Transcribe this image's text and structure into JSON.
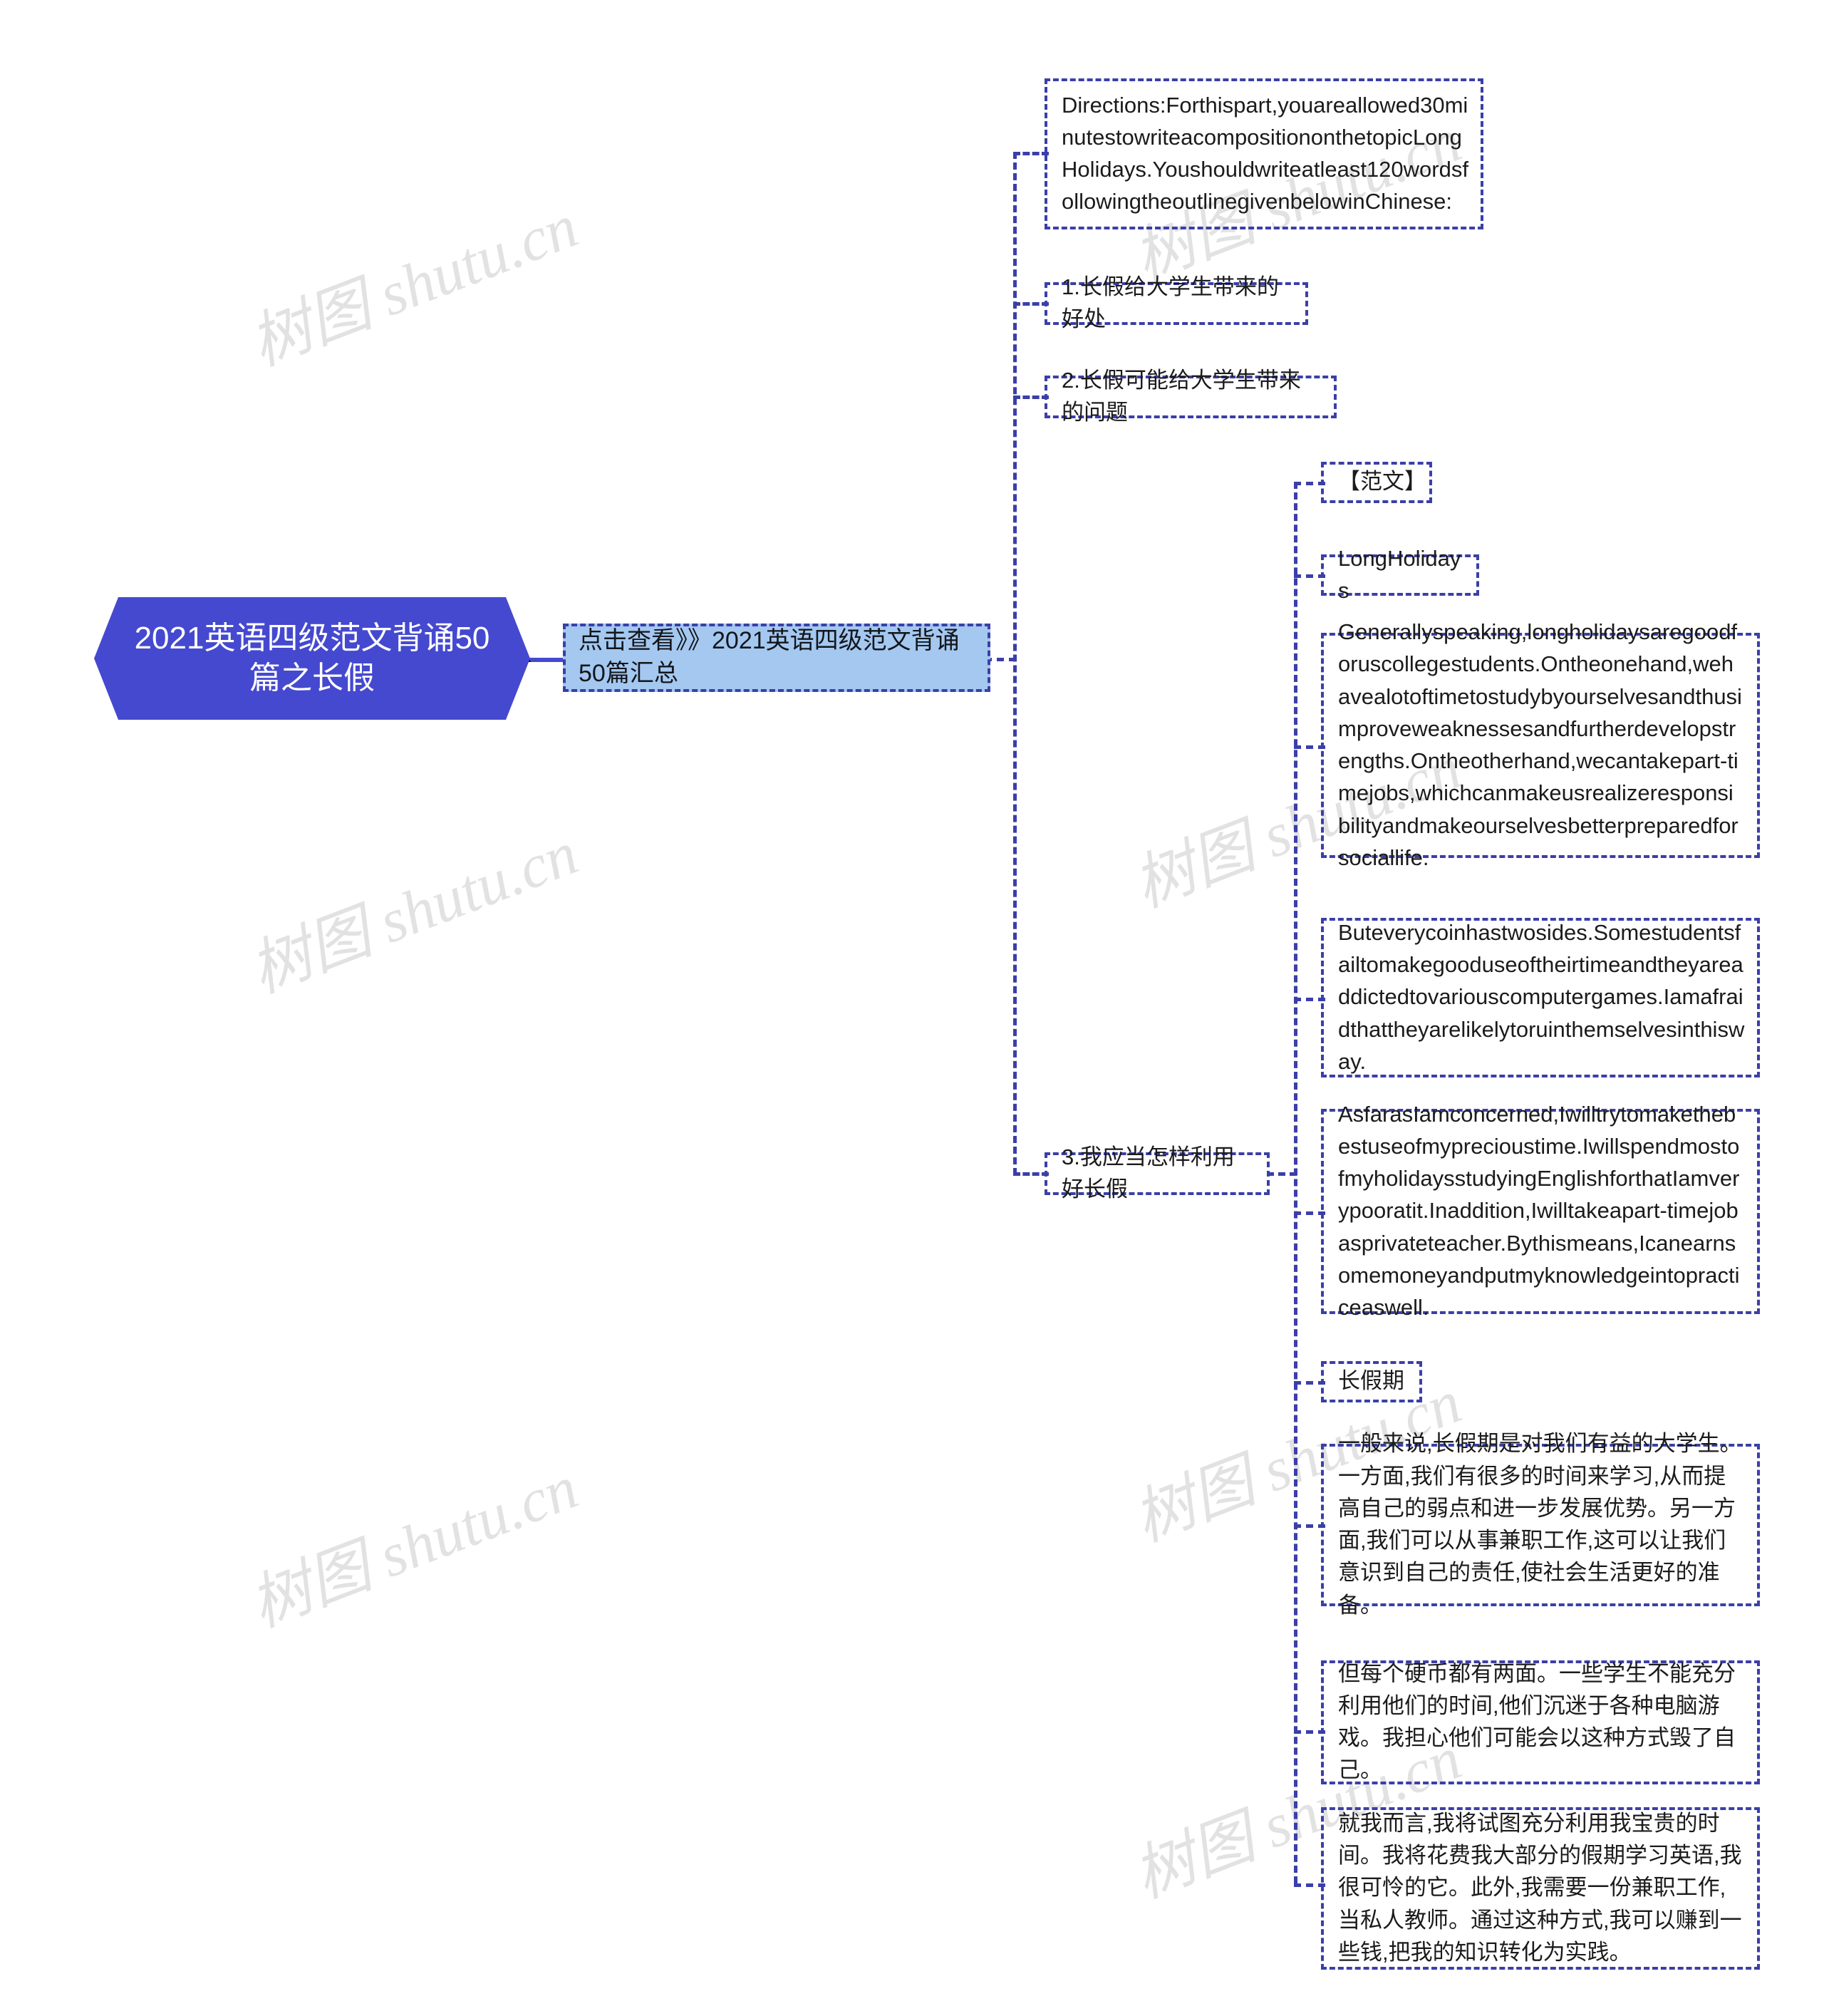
{
  "watermark": {
    "text": "树图 shutu.cn",
    "color": "#e2e2e2"
  },
  "colors": {
    "root_fill": "#4549cf",
    "root_text": "#ffffff",
    "level1_fill": "#a4c8f0",
    "border_dashed": "#3b3fa8",
    "body_text": "#1b1b1b",
    "page_background": "#ffffff"
  },
  "mindmap": {
    "root": {
      "label": "2021英语四级范文背诵50篇之长假"
    },
    "level1": {
      "label": "点击查看》》2021英语四级范文背诵50篇汇总"
    },
    "outline": [
      {
        "id": "directions",
        "label": "Directions:Forthispart,youareallowed30minutestowriteacompositiononthetopicLongHolidays.Youshouldwriteatleast120wordsfollowingtheoutlinegivenbelowinChinese:"
      },
      {
        "id": "point-1",
        "label": "1.长假给大学生带来的好处"
      },
      {
        "id": "point-2",
        "label": "2.长假可能给大学生带来的问题"
      },
      {
        "id": "point-3",
        "label": "3.我应当怎样利用好长假"
      }
    ],
    "essay": [
      {
        "id": "sample-heading",
        "label": "【范文】"
      },
      {
        "id": "essay-title",
        "label": "LongHolidays"
      },
      {
        "id": "essay-para-1",
        "label": "Generallyspeaking,longholidaysaregoodforuscollegestudents.Ontheonehand,wehavealotoftimetostudybyourselvesandthusimproveweaknessesandfurtherdevelopstrengths.Ontheotherhand,wecantakepart-timejobs,whichcanmakeusrealizeresponsibilityandmakeourselvesbetterpreparedforsociallife."
      },
      {
        "id": "essay-para-2",
        "label": "Buteverycoinhastwosides.Somestudentsfailtomakegooduseoftheirtimeandtheyareaddictedtovariouscomputergames.Iamafraidthattheyarelikelytoruinthemselvesinthisway."
      },
      {
        "id": "essay-para-3",
        "label": "AsfarasIamconcerned,Iwilltrytomakethebestuseofmyprecioustime.IwillspendmostofmyholidaysstudyingEnglishforthatIamverypooratit.Inaddition,Iwilltakeapart-timejobasprivateteacher.Bythismeans,Icanearnsomemoneyandputmyknowledgeintopracticeaswell."
      },
      {
        "id": "translation-title",
        "label": "长假期"
      },
      {
        "id": "translation-para-1",
        "label": "一般来说,长假期是对我们有益的大学生。一方面,我们有很多的时间来学习,从而提高自己的弱点和进一步发展优势。另一方面,我们可以从事兼职工作,这可以让我们意识到自己的责任,使社会生活更好的准备。"
      },
      {
        "id": "translation-para-2",
        "label": "但每个硬币都有两面。一些学生不能充分利用他们的时间,他们沉迷于各种电脑游戏。我担心他们可能会以这种方式毁了自己。"
      },
      {
        "id": "translation-para-3",
        "label": "就我而言,我将试图充分利用我宝贵的时间。我将花费我大部分的假期学习英语,我很可怜的它。此外,我需要一份兼职工作,当私人教师。通过这种方式,我可以赚到一些钱,把我的知识转化为实践。"
      }
    ]
  }
}
